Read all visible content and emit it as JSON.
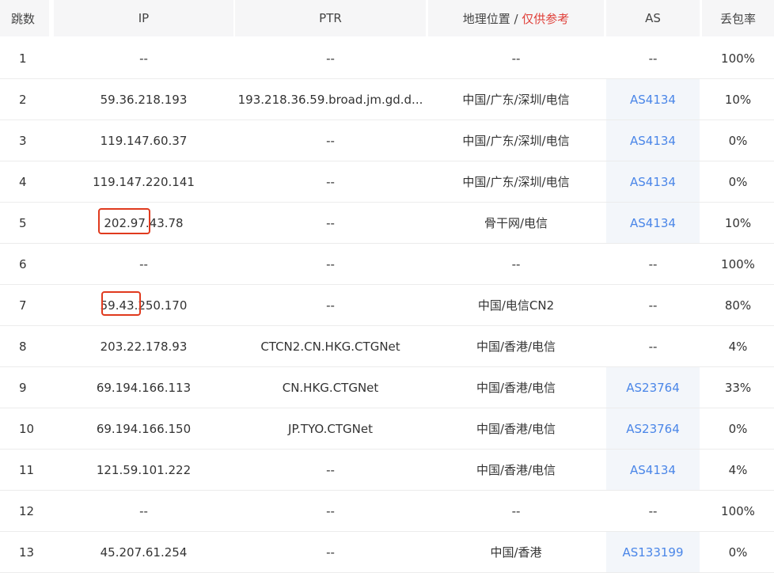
{
  "columns": {
    "hop": "跳数",
    "ip": "IP",
    "ptr": "PTR",
    "geo_prefix": "地理位置 / ",
    "geo_note": "仅供参考",
    "as": "AS",
    "loss": "丢包率"
  },
  "colors": {
    "as_link": "#4a86e8",
    "geo_note": "#e0403a",
    "highlight": "#e03a1e",
    "header_bg": "#f6f6f7"
  },
  "rows": [
    {
      "hop": "1",
      "ip": "--",
      "ptr": "--",
      "geo": "--",
      "as": "--",
      "loss": "100%",
      "as_link": false
    },
    {
      "hop": "2",
      "ip": "59.36.218.193",
      "ptr": "193.218.36.59.broad.jm.gd.d...",
      "geo": "中国/广东/深圳/电信",
      "as": "AS4134",
      "loss": "10%",
      "as_link": true
    },
    {
      "hop": "3",
      "ip": "119.147.60.37",
      "ptr": "--",
      "geo": "中国/广东/深圳/电信",
      "as": "AS4134",
      "loss": "0%",
      "as_link": true
    },
    {
      "hop": "4",
      "ip": "119.147.220.141",
      "ptr": "--",
      "geo": "中国/广东/深圳/电信",
      "as": "AS4134",
      "loss": "0%",
      "as_link": true
    },
    {
      "hop": "5",
      "ip": "202.97.43.78",
      "ptr": "--",
      "geo": "骨干网/电信",
      "as": "AS4134",
      "loss": "10%",
      "as_link": true
    },
    {
      "hop": "6",
      "ip": "--",
      "ptr": "--",
      "geo": "--",
      "as": "--",
      "loss": "100%",
      "as_link": false
    },
    {
      "hop": "7",
      "ip": "59.43.250.170",
      "ptr": "--",
      "geo": "中国/电信CN2",
      "as": "--",
      "loss": "80%",
      "as_link": false
    },
    {
      "hop": "8",
      "ip": "203.22.178.93",
      "ptr": "CTCN2.CN.HKG.CTGNet",
      "geo": "中国/香港/电信",
      "as": "--",
      "loss": "4%",
      "as_link": false
    },
    {
      "hop": "9",
      "ip": "69.194.166.113",
      "ptr": "CN.HKG.CTGNet",
      "geo": "中国/香港/电信",
      "as": "AS23764",
      "loss": "33%",
      "as_link": true
    },
    {
      "hop": "10",
      "ip": "69.194.166.150",
      "ptr": "JP.TYO.CTGNet",
      "geo": "中国/香港/电信",
      "as": "AS23764",
      "loss": "0%",
      "as_link": true
    },
    {
      "hop": "11",
      "ip": "121.59.101.222",
      "ptr": "--",
      "geo": "中国/香港/电信",
      "as": "AS4134",
      "loss": "4%",
      "as_link": true
    },
    {
      "hop": "12",
      "ip": "--",
      "ptr": "--",
      "geo": "--",
      "as": "--",
      "loss": "100%",
      "as_link": false
    },
    {
      "hop": "13",
      "ip": "45.207.61.254",
      "ptr": "--",
      "geo": "中国/香港",
      "as": "AS133199",
      "loss": "0%",
      "as_link": true
    }
  ]
}
